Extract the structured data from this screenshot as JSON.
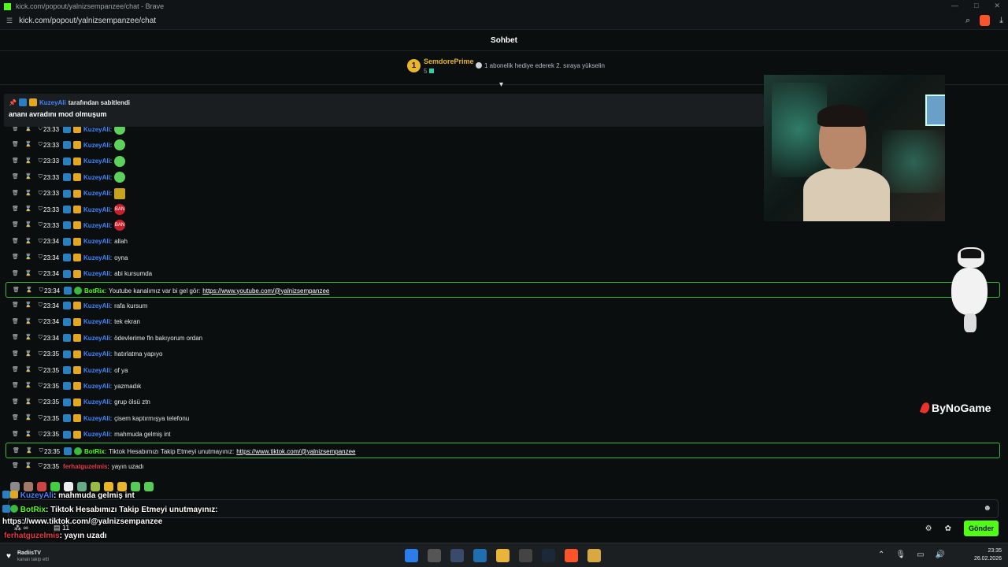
{
  "window": {
    "title": "kick.com/popout/yalnizsempanzee/chat - Brave",
    "address": "kick.com/popout/yalnizsempanzee/chat"
  },
  "chat": {
    "header": "Sohbet",
    "leaderboard": {
      "rank": "1",
      "name": "SemdorePrime",
      "count": "5",
      "hint": "1 abonelik hediye ederek 2. sıraya yükselin"
    },
    "pinned": {
      "user": "KuzeyAli",
      "suffix": "tarafından sabitlendi",
      "message": "ananı avradını mod olmuşum"
    },
    "messages": [
      {
        "time": "23:33",
        "user": "KuzeyAli",
        "text": "",
        "emote": "green-emote"
      },
      {
        "time": "23:33",
        "user": "KuzeyAli",
        "text": "",
        "emote": "green-emote"
      },
      {
        "time": "23:33",
        "user": "KuzeyAli",
        "text": "",
        "emote": "green-emote"
      },
      {
        "time": "23:33",
        "user": "KuzeyAli",
        "text": "",
        "emote": "green-emote"
      },
      {
        "time": "23:33",
        "user": "KuzeyAli",
        "text": "",
        "emote": "yellow-emote"
      },
      {
        "time": "23:33",
        "user": "KuzeyAli",
        "text": "",
        "emote": "ban-emote"
      },
      {
        "time": "23:33",
        "user": "KuzeyAli",
        "text": "",
        "emote": "ban-emote"
      },
      {
        "time": "23:34",
        "user": "KuzeyAli",
        "text": "allah"
      },
      {
        "time": "23:34",
        "user": "KuzeyAli",
        "text": "oyna"
      },
      {
        "time": "23:34",
        "user": "KuzeyAli",
        "text": "abi kursumda"
      },
      {
        "time": "23:34",
        "user": "BotRix",
        "text": "Youtube kanalımız var bi gel gör:",
        "link": "https://www.youtube.com/@yalnizsempanzee",
        "bot": true
      },
      {
        "time": "23:34",
        "user": "KuzeyAli",
        "text": "rafa kursum"
      },
      {
        "time": "23:34",
        "user": "KuzeyAli",
        "text": "tek ekran"
      },
      {
        "time": "23:34",
        "user": "KuzeyAli",
        "text": "ödevlerime fln bakıyorum ordan"
      },
      {
        "time": "23:35",
        "user": "KuzeyAli",
        "text": "hatırlatma yapıyo"
      },
      {
        "time": "23:35",
        "user": "KuzeyAli",
        "text": "of ya"
      },
      {
        "time": "23:35",
        "user": "KuzeyAli",
        "text": "yazmadık"
      },
      {
        "time": "23:35",
        "user": "KuzeyAli",
        "text": "grup ölsü ztn"
      },
      {
        "time": "23:35",
        "user": "KuzeyAli",
        "text": "çisem kaptırmışya telefonu"
      },
      {
        "time": "23:35",
        "user": "KuzeyAli",
        "text": "mahmuda gelmiş int"
      },
      {
        "time": "23:35",
        "user": "BotRix",
        "text": "Tiktok Hesabımızı Takip Etmeyi unutmayınız:",
        "link": "https://www.tiktok.com/@yalnizsempanzee",
        "bot": true
      },
      {
        "time": "23:35",
        "user": "ferhatguzelmis",
        "text": "yayın uzadı",
        "red": true
      }
    ],
    "ban_label": "BAN",
    "send_button": "Gönder",
    "viewers_infinity": "∞",
    "viewers_count": "11"
  },
  "overlay": {
    "line1_user": "KuzeyAli",
    "line1_text": ": mahmuda gelmiş int",
    "line2_user": "BotRix",
    "line2_text": ": Tiktok Hesabımızı Takip Etmeyi unutmayınız:",
    "line3": "https://www.tiktok.com/@yalnizsempanzee",
    "line4_user": "ferhatguzelmis",
    "line4_text": ": yayın uzadı",
    "brand": "ByNoGame"
  },
  "taskbar": {
    "widget_title": "RadiisTV",
    "widget_sub": "kanalı takip etti",
    "time": "23:35",
    "date": "26.02.2026"
  },
  "colors": {
    "kick_green": "#53fc18",
    "mod_blue": "#3f86ff",
    "leader_gold": "#e9b52a"
  }
}
